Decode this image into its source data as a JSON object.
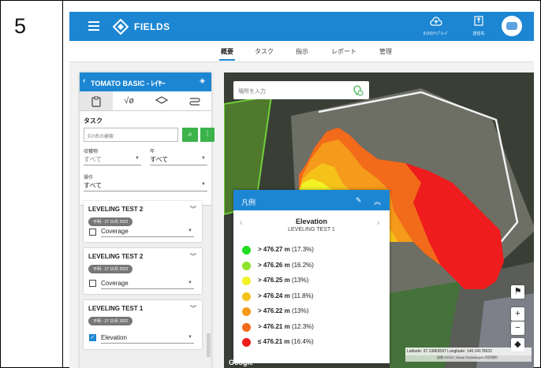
{
  "row_number": "5",
  "app": {
    "brand": "FIELDS"
  },
  "topbar": {
    "buttons": [
      {
        "icon": "cloud-upload-icon",
        "label": "ﾀｽｸのｱｯﾌﾟﾛｰﾄﾞ"
      },
      {
        "icon": "export-icon",
        "label": "送信先"
      }
    ]
  },
  "tabs": [
    {
      "label": "概要",
      "active": true
    },
    {
      "label": "タスク",
      "active": false
    },
    {
      "label": "指示",
      "active": false
    },
    {
      "label": "レポート",
      "active": false
    },
    {
      "label": "管理",
      "active": false
    }
  ],
  "panel": {
    "title": "TOMATO BASIC - ﾚｲﾔｰ",
    "task_section_title": "タスク",
    "search_placeholder": "ﾀｽｸ名の検索",
    "filters": {
      "crop_label": "収穫物",
      "crop_value": "すべて",
      "year_label": "年",
      "year_value": "すべて",
      "operation_label": "操作",
      "operation_value": "すべて"
    },
    "layers": [
      {
        "title": "LEVELING TEST 2",
        "date": "不明 - 27 10月 2022",
        "layer": "Coverage",
        "checked": false
      },
      {
        "title": "LEVELING TEST 2",
        "date": "不明 - 27 10月 2022",
        "layer": "Coverage",
        "checked": false
      },
      {
        "title": "LEVELING TEST 1",
        "date": "不明 - 27 10月 2022",
        "layer": "Elevation",
        "checked": true
      }
    ]
  },
  "map": {
    "search_placeholder": "場所を入力",
    "coords_text": "Latitude: 37.13863597  Longitude: 140.14178932",
    "attribution": "画像 ©2022 , Maxar Technologies  利用規約",
    "google": "Google"
  },
  "legend": {
    "header": "凡例",
    "title": "Elevation",
    "subtitle": "LEVELING TEST 1",
    "rows": [
      {
        "color": "#22dd22",
        "value": "> 476.27 m",
        "pct": "(17.3%)"
      },
      {
        "color": "#8ee32a",
        "value": "> 476.26 m",
        "pct": "(16.2%)"
      },
      {
        "color": "#f2f224",
        "value": "> 476.25 m",
        "pct": "(13%)"
      },
      {
        "color": "#f5c21a",
        "value": "> 476.24 m",
        "pct": "(11.8%)"
      },
      {
        "color": "#f59a1a",
        "value": "> 476.22 m",
        "pct": "(13%)"
      },
      {
        "color": "#f26b1a",
        "value": "> 476.21 m",
        "pct": "(12.3%)"
      },
      {
        "color": "#ee1c1c",
        "value": "≤ 476.21 m",
        "pct": "(16.4%)"
      }
    ]
  }
}
